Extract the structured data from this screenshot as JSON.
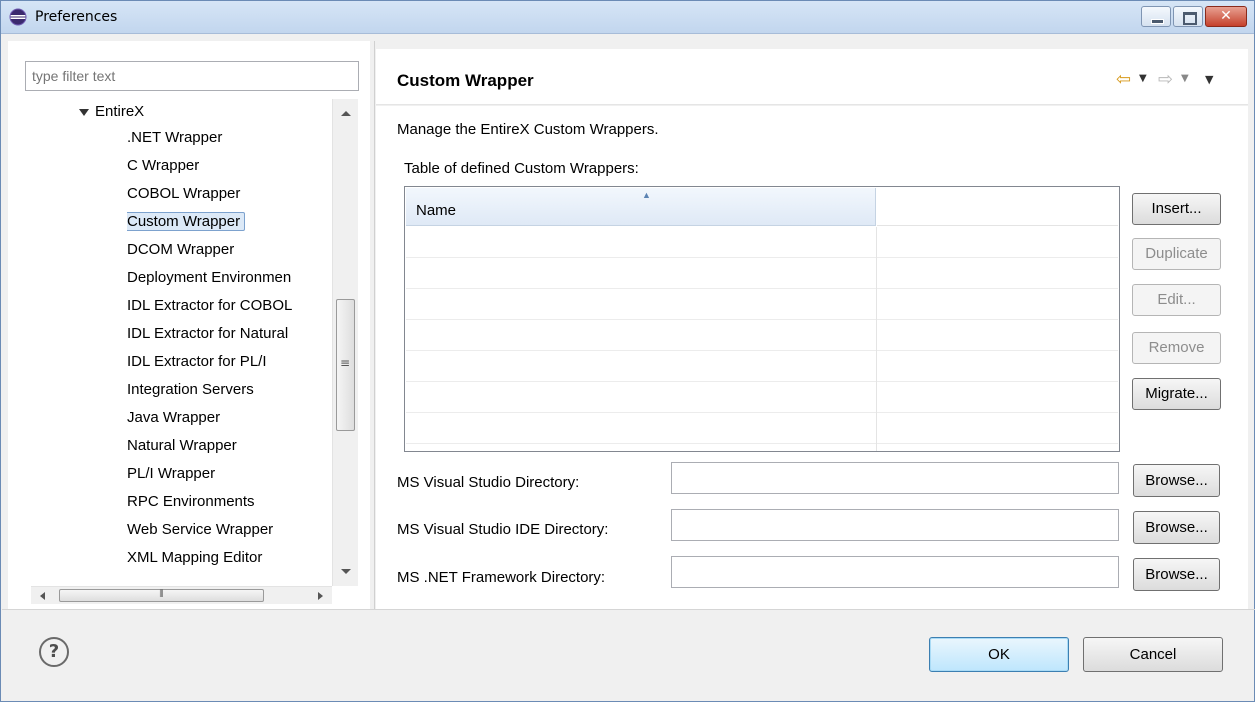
{
  "window": {
    "title": "Preferences"
  },
  "filter": {
    "placeholder": "type filter text"
  },
  "tree": {
    "parent": "EntireX",
    "items": [
      ".NET Wrapper",
      "C Wrapper",
      "COBOL Wrapper",
      "Custom Wrapper",
      "DCOM Wrapper",
      "Deployment Environmen",
      "IDL Extractor for COBOL",
      "IDL Extractor for Natural",
      "IDL Extractor for PL/I",
      "Integration Servers",
      "Java Wrapper",
      "Natural Wrapper",
      "PL/I Wrapper",
      "RPC Environments",
      "Web Service Wrapper",
      "XML Mapping Editor"
    ],
    "selected": "Custom Wrapper"
  },
  "page": {
    "title": "Custom Wrapper",
    "description": "Manage the EntireX Custom Wrappers.",
    "table_label": "Table of defined Custom Wrappers:",
    "table": {
      "columns": [
        "Name",
        ""
      ],
      "rows": []
    }
  },
  "buttons": {
    "insert": "Insert...",
    "duplicate": "Duplicate",
    "edit": "Edit...",
    "remove": "Remove",
    "migrate": "Migrate...",
    "browse": "Browse...",
    "ok": "OK",
    "cancel": "Cancel"
  },
  "fields": {
    "ms_vs_dir": {
      "label": "MS Visual Studio Directory:",
      "value": ""
    },
    "ms_vs_ide_dir": {
      "label": "MS Visual Studio IDE Directory:",
      "value": ""
    },
    "ms_net_dir": {
      "label": "MS .NET Framework Directory:",
      "value": ""
    }
  },
  "icons": {
    "app": "eclipse-icon",
    "back": "back-arrow-icon",
    "forward": "forward-arrow-icon",
    "view_menu": "view-menu-icon",
    "help": "help-icon"
  },
  "colors": {
    "selection": "#dce9f7",
    "back_arrow": "#d79a1c",
    "default_button": "#bee6fd"
  }
}
